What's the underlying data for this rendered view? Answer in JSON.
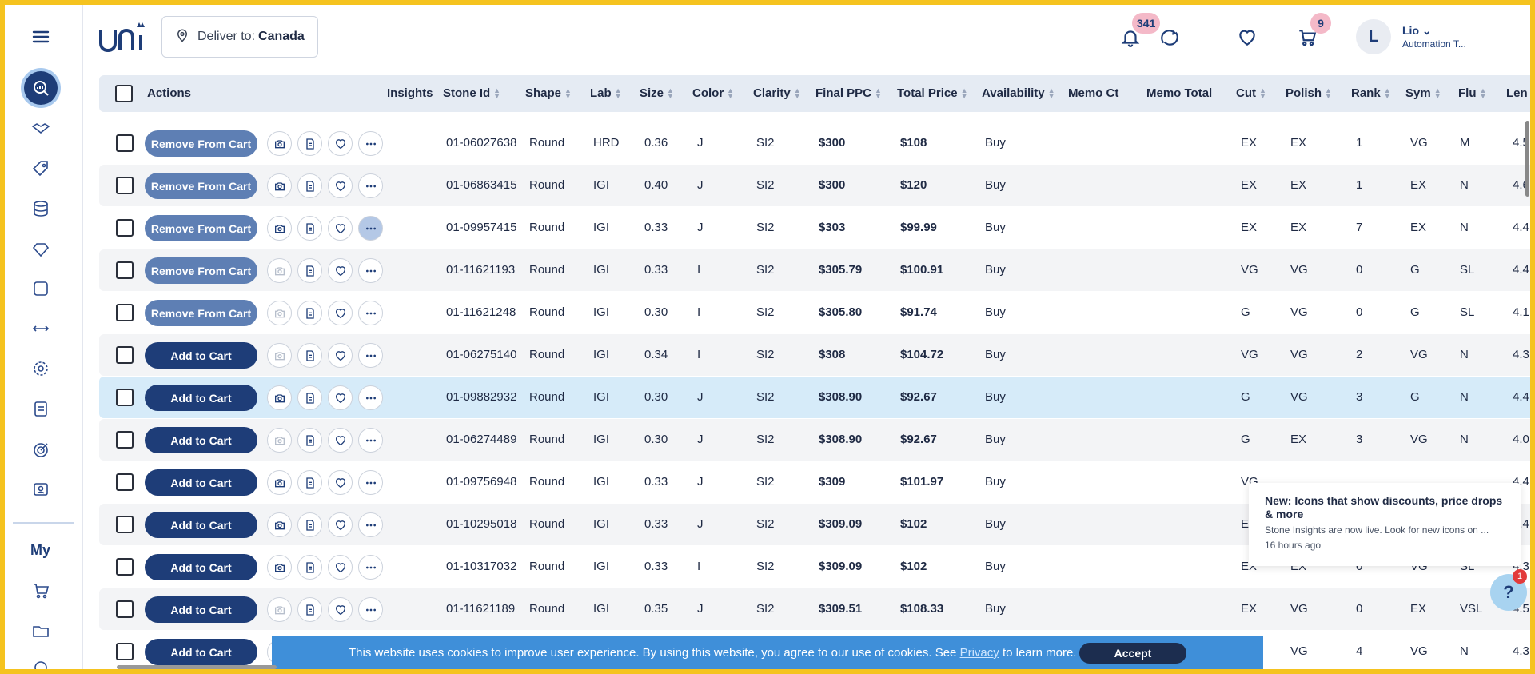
{
  "app": {
    "brand": "uni"
  },
  "header": {
    "deliver_prefix": "Deliver to:",
    "deliver_country": "Canada",
    "notifications_count": "341",
    "cart_count": "9",
    "user_initial": "L",
    "user_name": "Lio",
    "user_role": "Automation T..."
  },
  "sidebar": {
    "my_label": "My",
    "icons": [
      "analytics-icon",
      "handshake-icon",
      "tag-icon",
      "database-icon",
      "diamond-icon",
      "square-icon",
      "arrows-horizontal-icon",
      "gear-icon",
      "clipboard-icon",
      "target-icon",
      "user-badge-icon",
      "cart-icon",
      "folder-dollar-icon",
      "settings-icon"
    ]
  },
  "table": {
    "columns": [
      "Actions",
      "Insights",
      "Stone Id",
      "Shape",
      "Lab",
      "Size",
      "Color",
      "Clarity",
      "Final PPC",
      "Total Price",
      "Availability",
      "Memo Ct",
      "Memo Total",
      "Cut",
      "Polish",
      "Rank",
      "Sym",
      "Flu",
      "Len"
    ],
    "labels": {
      "remove": "Remove From Cart",
      "add": "Add to Cart"
    },
    "rows": [
      {
        "action": "remove",
        "camera": true,
        "stone_id": "01-06027638",
        "shape": "Round",
        "lab": "HRD",
        "size": "0.36",
        "color": "J",
        "clarity": "SI2",
        "ppc": "$300",
        "total": "$108",
        "avail": "Buy",
        "cut": "EX",
        "polish": "EX",
        "rank": "1",
        "sym": "VG",
        "flu": "M",
        "len": "4.5"
      },
      {
        "action": "remove",
        "camera": true,
        "stone_id": "01-06863415",
        "shape": "Round",
        "lab": "IGI",
        "size": "0.40",
        "color": "J",
        "clarity": "SI2",
        "ppc": "$300",
        "total": "$120",
        "avail": "Buy",
        "cut": "EX",
        "polish": "EX",
        "rank": "1",
        "sym": "EX",
        "flu": "N",
        "len": "4.6"
      },
      {
        "action": "remove",
        "camera": true,
        "stone_id": "01-09957415",
        "shape": "Round",
        "lab": "IGI",
        "size": "0.33",
        "color": "J",
        "clarity": "SI2",
        "ppc": "$303",
        "total": "$99.99",
        "avail": "Buy",
        "cut": "EX",
        "polish": "EX",
        "rank": "7",
        "sym": "EX",
        "flu": "N",
        "len": "4.4",
        "more_selected": true
      },
      {
        "action": "remove",
        "camera": false,
        "stone_id": "01-11621193",
        "shape": "Round",
        "lab": "IGI",
        "size": "0.33",
        "color": "I",
        "clarity": "SI2",
        "ppc": "$305.79",
        "total": "$100.91",
        "avail": "Buy",
        "cut": "VG",
        "polish": "VG",
        "rank": "0",
        "sym": "G",
        "flu": "SL",
        "len": "4.4"
      },
      {
        "action": "remove",
        "camera": false,
        "stone_id": "01-11621248",
        "shape": "Round",
        "lab": "IGI",
        "size": "0.30",
        "color": "I",
        "clarity": "SI2",
        "ppc": "$305.80",
        "total": "$91.74",
        "avail": "Buy",
        "cut": "G",
        "polish": "VG",
        "rank": "0",
        "sym": "G",
        "flu": "SL",
        "len": "4.1"
      },
      {
        "action": "add",
        "camera": false,
        "stone_id": "01-06275140",
        "shape": "Round",
        "lab": "IGI",
        "size": "0.34",
        "color": "I",
        "clarity": "SI2",
        "ppc": "$308",
        "total": "$104.72",
        "avail": "Buy",
        "cut": "VG",
        "polish": "VG",
        "rank": "2",
        "sym": "VG",
        "flu": "N",
        "len": "4.3"
      },
      {
        "action": "add",
        "camera": true,
        "stone_id": "01-09882932",
        "shape": "Round",
        "lab": "IGI",
        "size": "0.30",
        "color": "J",
        "clarity": "SI2",
        "ppc": "$308.90",
        "total": "$92.67",
        "avail": "Buy",
        "cut": "G",
        "polish": "VG",
        "rank": "3",
        "sym": "G",
        "flu": "N",
        "len": "4.4",
        "highlight": true
      },
      {
        "action": "add",
        "camera": false,
        "stone_id": "01-06274489",
        "shape": "Round",
        "lab": "IGI",
        "size": "0.30",
        "color": "J",
        "clarity": "SI2",
        "ppc": "$308.90",
        "total": "$92.67",
        "avail": "Buy",
        "cut": "G",
        "polish": "EX",
        "rank": "3",
        "sym": "VG",
        "flu": "N",
        "len": "4.0"
      },
      {
        "action": "add",
        "camera": true,
        "stone_id": "01-09756948",
        "shape": "Round",
        "lab": "IGI",
        "size": "0.33",
        "color": "J",
        "clarity": "SI2",
        "ppc": "$309",
        "total": "$101.97",
        "avail": "Buy",
        "cut": "VG",
        "polish": "",
        "rank": "",
        "sym": "",
        "flu": "",
        "len": "4.4"
      },
      {
        "action": "add",
        "camera": true,
        "stone_id": "01-10295018",
        "shape": "Round",
        "lab": "IGI",
        "size": "0.33",
        "color": "J",
        "clarity": "SI2",
        "ppc": "$309.09",
        "total": "$102",
        "avail": "Buy",
        "cut": "EX",
        "polish": "",
        "rank": "",
        "sym": "",
        "flu": "",
        "len": "4.4"
      },
      {
        "action": "add",
        "camera": true,
        "stone_id": "01-10317032",
        "shape": "Round",
        "lab": "IGI",
        "size": "0.33",
        "color": "I",
        "clarity": "SI2",
        "ppc": "$309.09",
        "total": "$102",
        "avail": "Buy",
        "cut": "EX",
        "polish": "EX",
        "rank": "0",
        "sym": "VG",
        "flu": "SL",
        "len": "4.3"
      },
      {
        "action": "add",
        "camera": false,
        "stone_id": "01-11621189",
        "shape": "Round",
        "lab": "IGI",
        "size": "0.35",
        "color": "J",
        "clarity": "SI2",
        "ppc": "$309.51",
        "total": "$108.33",
        "avail": "Buy",
        "cut": "EX",
        "polish": "VG",
        "rank": "0",
        "sym": "EX",
        "flu": "VSL",
        "len": "4.5"
      },
      {
        "action": "add",
        "camera": false,
        "stone_id": "",
        "shape": "",
        "lab": "",
        "size": "",
        "color": "",
        "clarity": "",
        "ppc": "",
        "total": "",
        "avail": "",
        "cut": "",
        "polish": "VG",
        "rank": "4",
        "sym": "VG",
        "flu": "N",
        "len": "4.3"
      }
    ]
  },
  "toast": {
    "title": "New: Icons that show discounts, price drops & more",
    "body": "Stone Insights are now live. Look for new icons on ...",
    "time": "16 hours ago"
  },
  "help": {
    "label": "?",
    "badge": "1"
  },
  "cookie": {
    "text_before": "This website uses cookies to improve user experience. By using this website, you agree to our use of cookies. See",
    "link": "Privacy",
    "text_after": "to learn more.",
    "accept": "Accept"
  },
  "colors": {
    "primary": "#1e3d78",
    "remove_button": "#5e7fb4",
    "highlight_row": "#d6ebf9",
    "cookie_bar": "#3f8fd9",
    "frame": "#f5c31f"
  }
}
